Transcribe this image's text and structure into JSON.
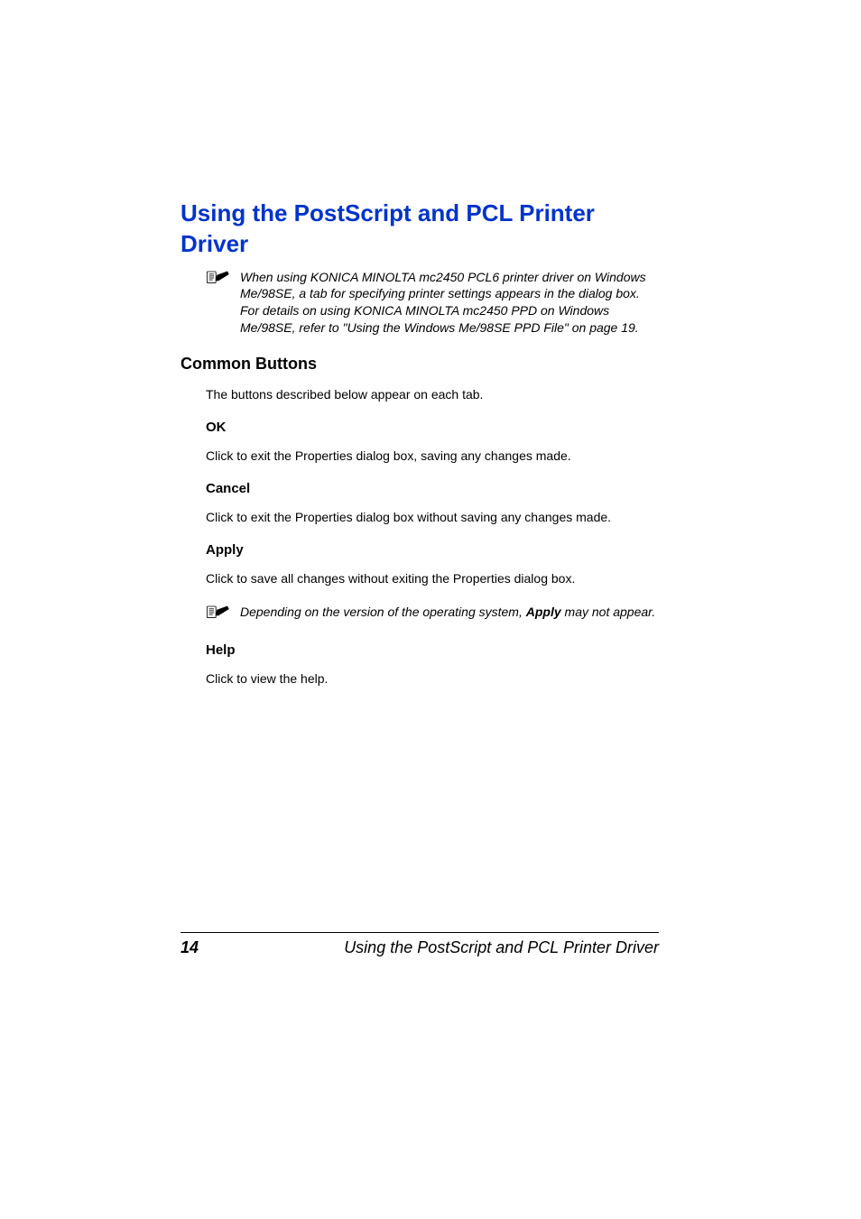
{
  "heading": "Using the PostScript and PCL Printer Driver",
  "topNote": {
    "line1": "When using KONICA MINOLTA mc2450 PCL6 printer driver on Windows Me/98SE, a tab for specifying printer settings appears in the dialog box.",
    "line2": "For details on using KONICA MINOLTA mc2450 PPD on Windows Me/98SE, refer to \"Using the Windows Me/98SE PPD File\" on page 19."
  },
  "commonButtons": {
    "heading": "Common Buttons",
    "intro": "The buttons described below appear on each tab."
  },
  "ok": {
    "heading": "OK",
    "text": "Click to exit the Properties dialog box, saving any changes made."
  },
  "cancel": {
    "heading": "Cancel",
    "text": "Click to exit the Properties dialog box without saving any changes made."
  },
  "apply": {
    "heading": "Apply",
    "text": "Click to save all changes without exiting the Properties dialog box.",
    "notePrefix": "Depending on the version of the operating system, ",
    "noteBold": "Apply",
    "noteSuffix": " may not appear."
  },
  "help": {
    "heading": "Help",
    "text": "Click to view the help."
  },
  "footer": {
    "pageNumber": "14",
    "title": "Using the PostScript and PCL Printer Driver"
  }
}
